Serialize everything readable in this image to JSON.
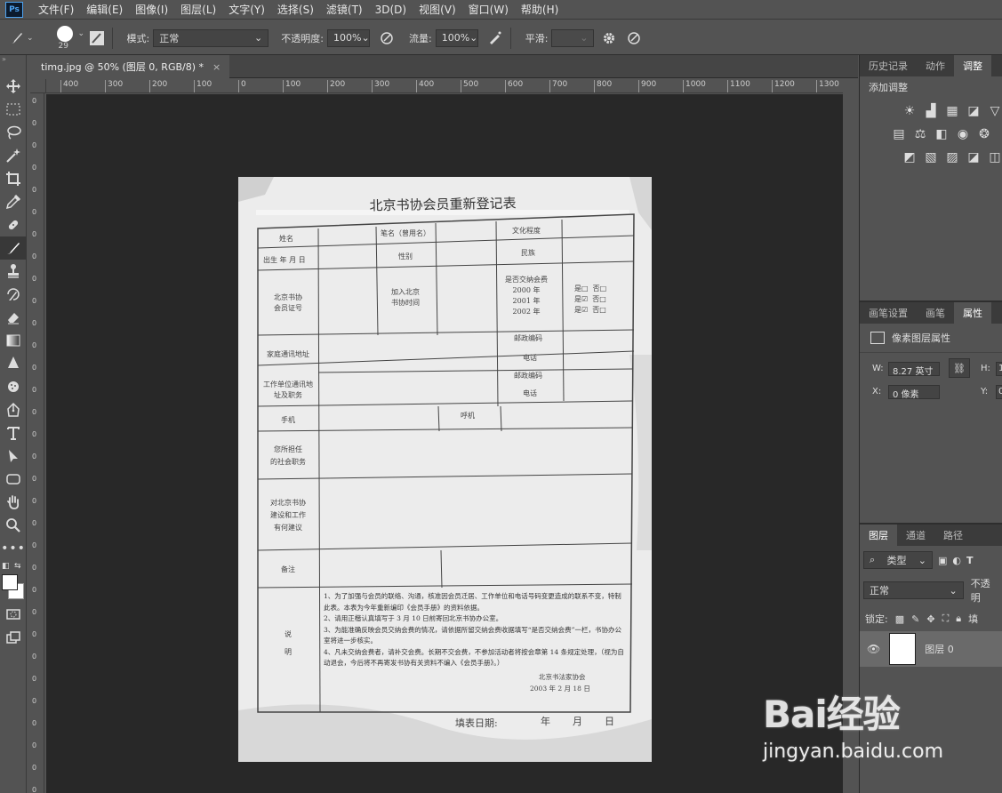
{
  "app": {
    "logo": "Ps"
  },
  "menu": [
    "文件(F)",
    "编辑(E)",
    "图像(I)",
    "图层(L)",
    "文字(Y)",
    "选择(S)",
    "滤镜(T)",
    "3D(D)",
    "视图(V)",
    "窗口(W)",
    "帮助(H)"
  ],
  "options": {
    "brush_size": "29",
    "mode_label": "模式:",
    "mode_value": "正常",
    "opacity_label": "不透明度:",
    "opacity_value": "100%",
    "flow_label": "流量:",
    "flow_value": "100%",
    "smoothing_label": "平滑:",
    "smoothing_value": ""
  },
  "tab": {
    "title": "timg.jpg @ 50% (图层 0, RGB/8) *",
    "close": "×"
  },
  "ruler_h": [
    "400",
    "300",
    "200",
    "100",
    "0",
    "100",
    "200",
    "300",
    "400",
    "500",
    "600",
    "700",
    "800",
    "900",
    "1000",
    "1100",
    "1200",
    "1300"
  ],
  "ruler_v": [
    "0",
    "0",
    "0",
    "0",
    "0",
    "0",
    "0",
    "0",
    "0",
    "0",
    "0",
    "0",
    "0",
    "0",
    "0",
    "0",
    "0",
    "0",
    "0",
    "0",
    "0",
    "0",
    "0",
    "0",
    "0",
    "0",
    "0",
    "0",
    "0",
    "0",
    "0",
    "0"
  ],
  "panels": {
    "top_tabs": [
      "历史记录",
      "动作",
      "调整"
    ],
    "adjust_title": "添加调整",
    "mid_tabs": [
      "画笔设置",
      "画笔",
      "属性"
    ],
    "props_title": "像素图层属性",
    "w_label": "W:",
    "w_value": "8.27 英寸",
    "h_label": "H:",
    "h_value": "1",
    "x_label": "X:",
    "x_value": "0 像素",
    "y_label": "Y:",
    "y_value": "0",
    "layers_tabs": [
      "图层",
      "通道",
      "路径"
    ],
    "kind": "类型",
    "blend": "正常",
    "opacity_short": "不透明",
    "lock_label": "锁定:",
    "lock_fill": "填",
    "layer_name": "图层 0"
  },
  "form": {
    "title": "北京书协会员重新登记表",
    "name": "姓名",
    "pen_name": "笔名（曾用名）",
    "education": "文化程度",
    "birth": "出生 年 月 日",
    "gender": "性别",
    "ethnicity": "民族",
    "member_no": "北京书协\n会员证号",
    "join_time": "加入北京\n书协时间",
    "fee_paid": "是否交纳会费\n2000 年\n2001 年\n2002 年",
    "fee_marks": "是□  否□\n是☑  否□\n是☑  否□",
    "home_addr": "家庭通讯地址",
    "postcode1": "邮政编码",
    "phone1": "电话",
    "work_addr": "工作单位通讯地\n址及职务",
    "postcode2": "邮政编码",
    "phone2": "电话",
    "mobile": "手机",
    "pager": "呼机",
    "social_role": "您所担任\n的社会职务",
    "suggest": "对北京书协\n建设和工作\n有何建议",
    "remark": "备注",
    "explain": "说\n\n明",
    "notes": [
      "1、为了加强与会员的联络、沟通，核准因会员迁居、工作单位和电话号码变更造成的联系不变，特制此表。本表为今年重新编印《会员手册》的资料依据。",
      "2、请用正楷认真填写于 3 月 10 日前寄回北京书协办公室。",
      "3、为能准确反映会员交纳会费的情况，请依据所留交纳会费收据填写“是否交纳会费”一栏，书协办公室将进一步核实。",
      "4、凡未交纳会费者，请补交会费。长期不交会费，不参加活动者将按会章第 14 条规定处理，（视为自动退会，今后将不再寄发书协有关资料不编入《会员手册》。）"
    ],
    "org": "北京书法家协会",
    "date": "2003 年 2 月 18 日",
    "fill_date": "填表日期:",
    "year": "年",
    "month": "月",
    "day": "日"
  },
  "watermark": {
    "logo": "Bai经验",
    "url": "jingyan.baidu.com"
  }
}
